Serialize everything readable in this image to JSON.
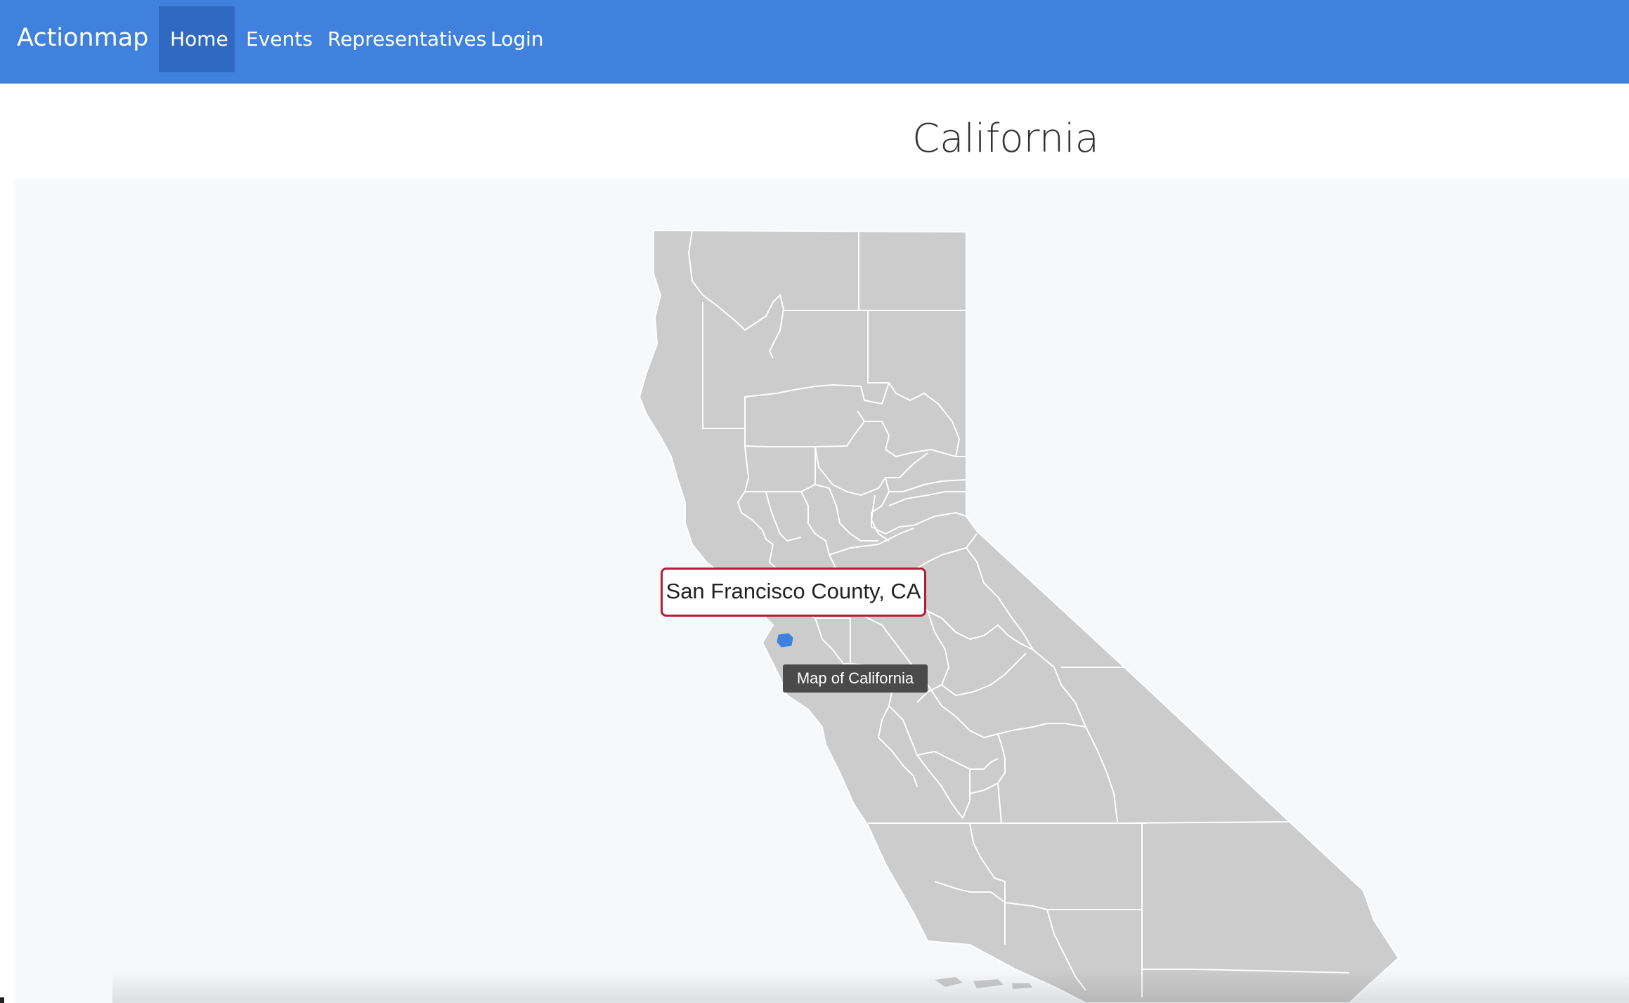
{
  "navbar": {
    "brand": "Actionmap",
    "items": [
      {
        "label": "Home",
        "active": true
      },
      {
        "label": "Events",
        "active": false
      },
      {
        "label": "Representatives",
        "active": false
      },
      {
        "label": "Login",
        "active": false
      }
    ],
    "color": "#3f81dd",
    "active_color": "#2f69c2"
  },
  "page": {
    "title": "California"
  },
  "map": {
    "fill_color": "#cccccc",
    "highlight_color": "#3f81dd",
    "selected_county_label": "San Francisco County, CA",
    "tooltip": "Map of California"
  }
}
